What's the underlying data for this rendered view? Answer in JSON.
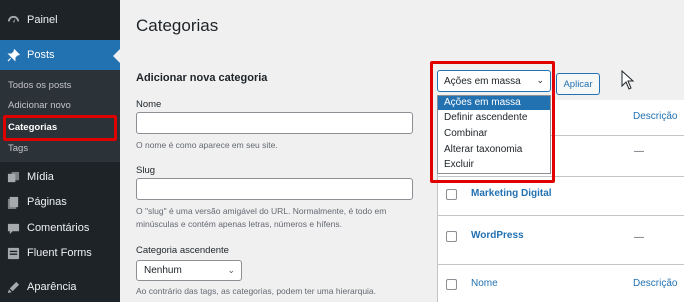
{
  "sidebar": {
    "items": [
      {
        "label": "Painel",
        "icon": "dashboard-icon"
      },
      {
        "label": "Posts",
        "icon": "pin-icon"
      },
      {
        "label": "Mídia",
        "icon": "media-icon"
      },
      {
        "label": "Páginas",
        "icon": "page-icon"
      },
      {
        "label": "Comentários",
        "icon": "comment-icon"
      },
      {
        "label": "Fluent Forms",
        "icon": "forms-icon"
      },
      {
        "label": "Aparência",
        "icon": "appearance-icon"
      }
    ],
    "submenu": [
      "Todos os posts",
      "Adicionar novo",
      "Categorias",
      "Tags"
    ]
  },
  "page": {
    "title": "Categorias"
  },
  "form": {
    "title": "Adicionar nova categoria",
    "name_label": "Nome",
    "name_help": "O nome é como aparece em seu site.",
    "slug_label": "Slug",
    "slug_help": "O \"slug\" é uma versão amigável do URL. Normalmente, é todo em minúsculas e contém apenas letras, números e hífens.",
    "parent_label": "Categoria ascendente",
    "parent_value": "Nenhum",
    "parent_help": "Ao contrário das tags, as categorias, podem ter uma hierarquia."
  },
  "bulk": {
    "selected": "Ações em massa",
    "apply": "Aplicar",
    "options": [
      "Ações em massa",
      "Definir ascendente",
      "Combinar",
      "Alterar taxonomia",
      "Excluir"
    ]
  },
  "table": {
    "header_desc": "Descrição",
    "rows": [
      {
        "name": "",
        "desc": "—"
      },
      {
        "name": "Marketing Digital",
        "desc": ""
      },
      {
        "name": "WordPress",
        "desc": "—"
      }
    ],
    "footer_name": "Nome",
    "footer_desc": "Descrição"
  },
  "colors": {
    "accent": "#2271b1",
    "highlight": "#e00000",
    "sidebar": "#1d2327"
  }
}
